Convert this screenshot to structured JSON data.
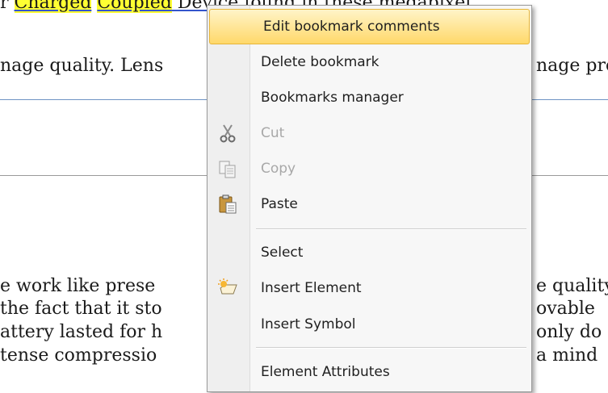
{
  "document": {
    "line1_pre": "r ",
    "line1_hl1": "Charged",
    "line1_space": " ",
    "line1_hl2": "Coupled",
    "line1_rest": " Device found in these megapixel",
    "line2": "nage quality. Lens",
    "line2_right": "nage pre",
    "body_lines": [
      {
        "left": "e work like prese",
        "right": "e quality"
      },
      {
        "left": "the fact that it sto",
        "right": "ovable"
      },
      {
        "left": "attery lasted for h",
        "right": "only do"
      },
      {
        "left": "tense compressio",
        "right": "a mind"
      }
    ]
  },
  "menu": {
    "items": [
      {
        "label": "Edit bookmark comments",
        "icon": "",
        "disabled": false,
        "highlighted": true
      },
      {
        "label": "Delete bookmark",
        "icon": "",
        "disabled": false
      },
      {
        "label": "Bookmarks manager",
        "icon": "",
        "disabled": false
      },
      {
        "label": "Cut",
        "icon": "scissors-icon",
        "disabled": true
      },
      {
        "label": "Copy",
        "icon": "copy-icon",
        "disabled": true
      },
      {
        "label": "Paste",
        "icon": "clipboard-icon",
        "disabled": false
      },
      {
        "label": "Select",
        "icon": "",
        "disabled": false
      },
      {
        "label": "Insert Element",
        "icon": "insert-element-icon",
        "disabled": false
      },
      {
        "label": "Insert Symbol",
        "icon": "",
        "disabled": false
      },
      {
        "label": "Element Attributes",
        "icon": "",
        "disabled": false
      }
    ],
    "highlight_color": "#ffd86a"
  }
}
